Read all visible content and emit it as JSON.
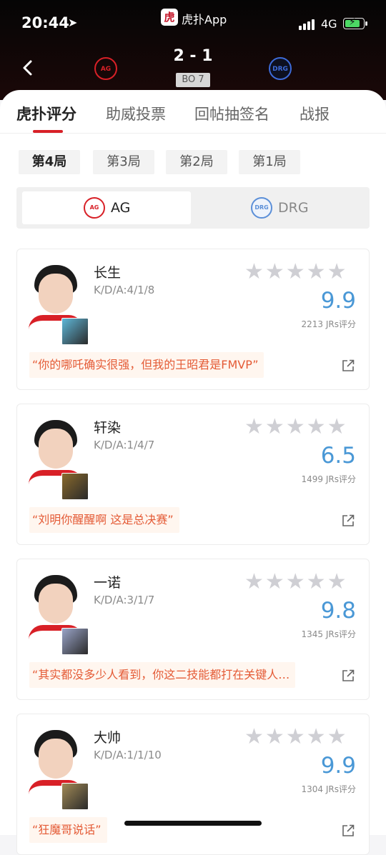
{
  "status": {
    "time": "20:44",
    "app": "虎扑App",
    "network": "4G"
  },
  "match": {
    "score": "2 - 1",
    "bo": "BO 7",
    "team_a_logo_text": "AG",
    "team_b_logo_text": "DRG"
  },
  "tabs": [
    "虎扑评分",
    "助威投票",
    "回帖抽签名",
    "战报"
  ],
  "games": [
    "第4局",
    "第3局",
    "第2局",
    "第1局"
  ],
  "teams": [
    "AG",
    "DRG"
  ],
  "players": [
    {
      "name": "长生",
      "kda": "K/D/A:4/1/8",
      "rating": "9.9",
      "votes": "2213 JRs评分",
      "quote": "“你的哪吒确实很强，但我的王昭君是FMVP”",
      "hero_color": "#5fb7d8"
    },
    {
      "name": "轩染",
      "kda": "K/D/A:1/4/7",
      "rating": "6.5",
      "votes": "1499 JRs评分",
      "quote": "“刘明你醒醒啊 这是总决赛”",
      "hero_color": "#8a6a2c"
    },
    {
      "name": "一诺",
      "kda": "K/D/A:3/1/7",
      "rating": "9.8",
      "votes": "1345 JRs评分",
      "quote": "“其实都没多少人看到，你这二技能都打在关键人…",
      "hero_color": "#9aa4c8"
    },
    {
      "name": "大帅",
      "kda": "K/D/A:1/1/10",
      "rating": "9.9",
      "votes": "1304 JRs评分",
      "quote": "“狂魔哥说话”",
      "hero_color": "#a28a56"
    }
  ],
  "stars": "★★★★★",
  "colors": {
    "accent": "#d82027",
    "rating": "#4a98d6",
    "quote": "#e45b36"
  }
}
